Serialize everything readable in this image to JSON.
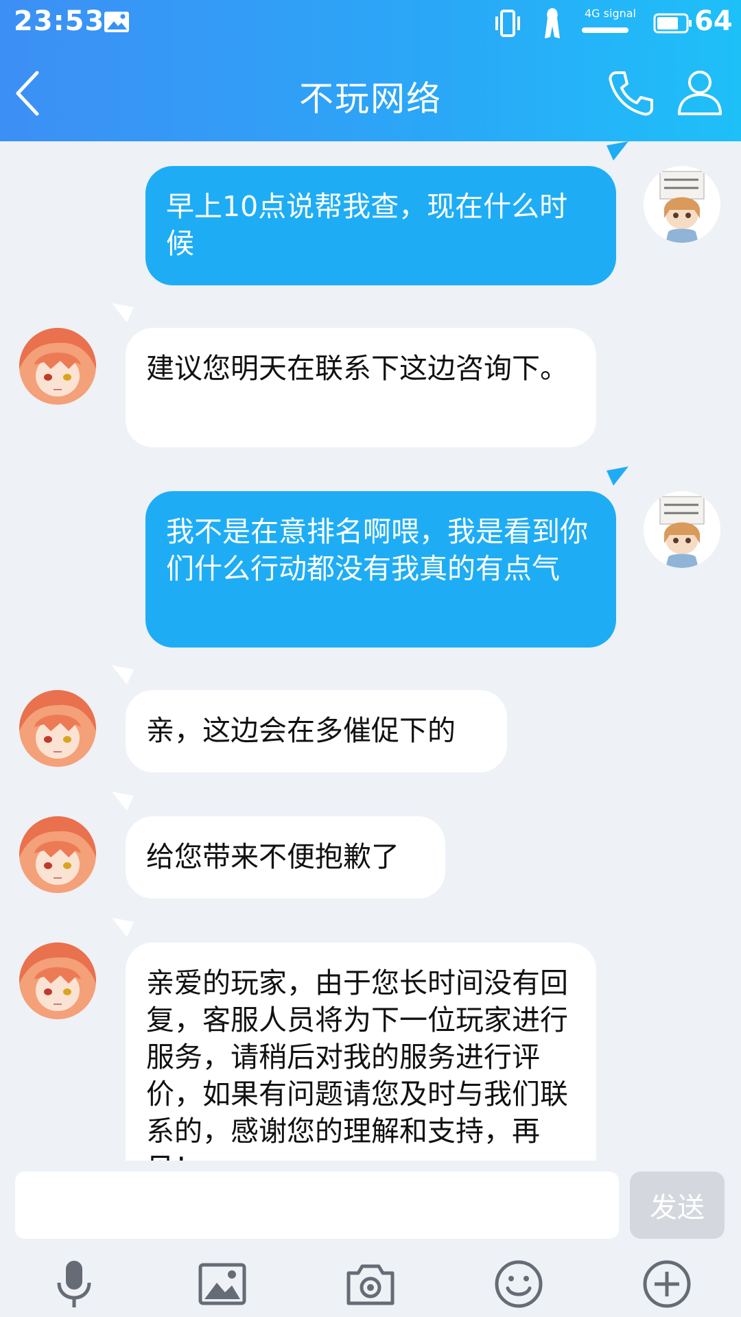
{
  "status_bar": {
    "time": "23:53",
    "signal_label": "4G signal",
    "battery_percent": "64"
  },
  "header": {
    "title": "不玩网络"
  },
  "messages": [
    {
      "side": "out",
      "text": "早上10点说帮我查，现在什么时候"
    },
    {
      "side": "in",
      "text": "建议您明天在联系下这边咨询下。"
    },
    {
      "side": "out",
      "text": "我不是在意排名啊喂，我是看到你们什么行动都没有我真的有点气"
    },
    {
      "side": "in",
      "text": "亲，这边会在多催促下的"
    },
    {
      "side": "in",
      "text": "给您带来不便抱歉了"
    },
    {
      "side": "in",
      "text": "亲爱的玩家，由于您长时间没有回复，客服人员将为下一位玩家进行服务，请稍后对我的服务进行评价，如果有问题请您及时与我们联系的，感谢您的理解和支持，再见！"
    }
  ],
  "input": {
    "value": "",
    "send_label": "发送"
  },
  "toolbar": [
    "microphone-icon",
    "image-icon",
    "camera-icon",
    "emoji-icon",
    "plus-icon"
  ],
  "colors": {
    "header_start": "#3d8ff5",
    "header_end": "#1ec0f8",
    "outgoing_bubble": "#1eadf5",
    "incoming_bubble": "#ffffff",
    "background": "#eef1f6"
  }
}
